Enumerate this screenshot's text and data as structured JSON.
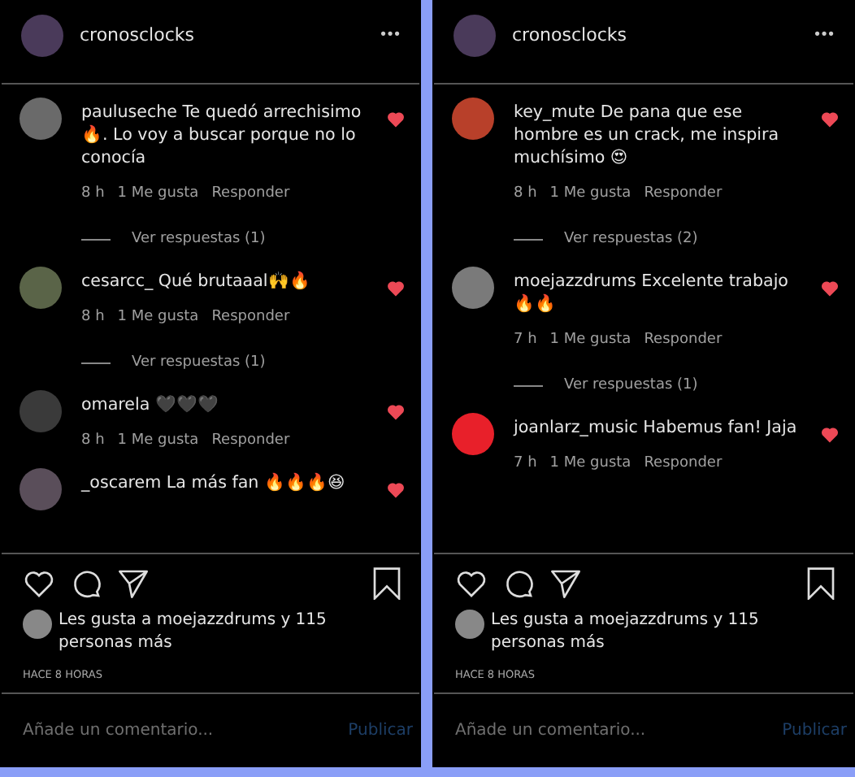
{
  "panels": [
    {
      "header": {
        "username": "cronosclocks",
        "menu": "•••"
      },
      "comments": [
        {
          "text": "pauluseche Te quedó arrechisimo 🔥. Lo voy a buscar porque no lo conocía",
          "liked": true,
          "time": "8 h",
          "likes": "1 Me gusta",
          "reply": "Responder",
          "replies": "Ver respuestas (1)"
        },
        {
          "text": "cesarcc_ Qué brutaaal🙌🔥",
          "liked": true,
          "time": "8 h",
          "likes": "1 Me gusta",
          "reply": "Responder",
          "replies": "Ver respuestas (1)"
        },
        {
          "text": "omarela 🖤🖤🖤",
          "liked": true,
          "time": "8 h",
          "likes": "1 Me gusta",
          "reply": "Responder"
        },
        {
          "text": "_oscarem La más fan 🔥🔥🔥😆",
          "liked": true
        }
      ],
      "footer": {
        "liked_by": "Les gusta a moejazzdrums y 115 personas más",
        "age": "HACE 8 HORAS",
        "placeholder": "Añade un comentario...",
        "publish": "Publicar"
      }
    },
    {
      "header": {
        "username": "cronosclocks",
        "menu": "•••"
      },
      "comments": [
        {
          "text": "key_mute De pana que ese hombre es un crack, me inspira muchísimo 😍",
          "liked": true,
          "time": "8 h",
          "likes": "1 Me gusta",
          "reply": "Responder",
          "replies": "Ver respuestas (2)"
        },
        {
          "text": "moejazzdrums Excelente trabajo 🔥🔥",
          "liked": true,
          "time": "7 h",
          "likes": "1 Me gusta",
          "reply": "Responder",
          "replies": "Ver respuestas (1)"
        },
        {
          "text": "joanlarz_music Habemus fan! Jaja",
          "liked": true,
          "time": "7 h",
          "likes": "1 Me gusta",
          "reply": "Responder"
        }
      ],
      "footer": {
        "liked_by": "Les gusta a moejazzdrums y 115 personas más",
        "age": "HACE 8 HORAS",
        "placeholder": "Añade un comentario...",
        "publish": "Publicar"
      }
    }
  ]
}
